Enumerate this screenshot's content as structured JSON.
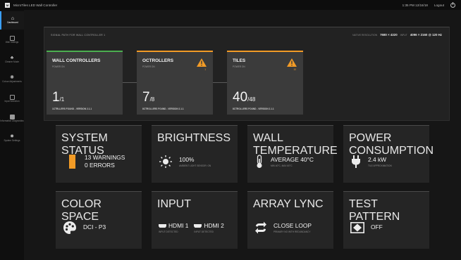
{
  "app": {
    "title": "MicroTiles LED Wall Controller"
  },
  "topbar": {
    "time": "1:35 PM 12/16/18",
    "user": "Logout"
  },
  "sidebar": {
    "items": [
      {
        "label": "Dashboard",
        "icon": "home-icon"
      },
      {
        "label": "Wall Settings",
        "icon": "wall-icon"
      },
      {
        "label": "Cleaner Mode",
        "icon": "broom-icon"
      },
      {
        "label": "Colour Adjustments",
        "icon": "palette-icon"
      },
      {
        "label": "Input Selection",
        "icon": "input-icon"
      },
      {
        "label": "Information Diagnostics",
        "icon": "diagnostics-icon"
      },
      {
        "label": "System Settings",
        "icon": "gear-icon"
      }
    ]
  },
  "signal_path": {
    "title": "SIGNAL PATH FOR WALL CONTROLLER 1",
    "native_label": "NATIVE RESOLUTION",
    "native_value": "7680 × 4320",
    "input_label": "INPUT",
    "input_value": "4096 × 2160 @ 120 Hz",
    "cards": [
      {
        "title": "WALL CONTROLLERS",
        "sub": "POWER ON",
        "count": "1",
        "total": "/1",
        "footer": "1CTRLLERS FOUND - VERSION 2.1.1",
        "warning": ""
      },
      {
        "title": "OCTROLLERS",
        "sub": "POWER ON",
        "count": "7",
        "total": "/8",
        "footer": "8CTROLLERS FOUND - VERSION 2.1.1",
        "warning": "1"
      },
      {
        "title": "TILES",
        "sub": "POWER ON",
        "count": "40",
        "total": "/48",
        "footer": "8CTROLLERS FOUND - VERSION 2.1.1",
        "warning": "10"
      }
    ]
  },
  "tiles_row1": [
    {
      "title": "SYSTEM STATUS",
      "line1": "13 WARNINGS",
      "line2": "0 ERRORS",
      "icon": "warning-bar-icon"
    },
    {
      "title": "BRIGHTNESS",
      "line1": "100%",
      "line2": "AMBIENT LIGHT SENSOR: ON",
      "icon": "sun-icon"
    },
    {
      "title": "WALL TEMPERATURE",
      "line1": "AVERAGE 40°C",
      "line2": "MIN 40°C, MAX 60°C",
      "icon": "thermometer-icon"
    },
    {
      "title": "POWER CONSUMPTION",
      "line1": "2.4 kW",
      "line2": "TILE APPROXIMATION",
      "icon": "plug-icon"
    }
  ],
  "tiles_row2": [
    {
      "title": "COLOR SPACE",
      "line1": "DCI - P3",
      "icon": "palette-icon"
    },
    {
      "title": "INPUT",
      "in1": "HDMI 1",
      "in1_sub": "INPUT DETECTED",
      "in2": "HDMI 2",
      "in2_sub": "INPUT DETECTED",
      "icon": "hdmi-icon"
    },
    {
      "title": "ARRAY LYNC",
      "line1": "CLOSE LOOP",
      "line2": "PRIMARY NO WITH REDUNDANCY",
      "icon": "sync-icon"
    },
    {
      "title": "TEST PATTERN",
      "line1": "OFF",
      "icon": "test-pattern-icon"
    }
  ],
  "colors": {
    "ok": "#4caf50",
    "warn": "#f29b26",
    "active": "#3a9fff"
  }
}
